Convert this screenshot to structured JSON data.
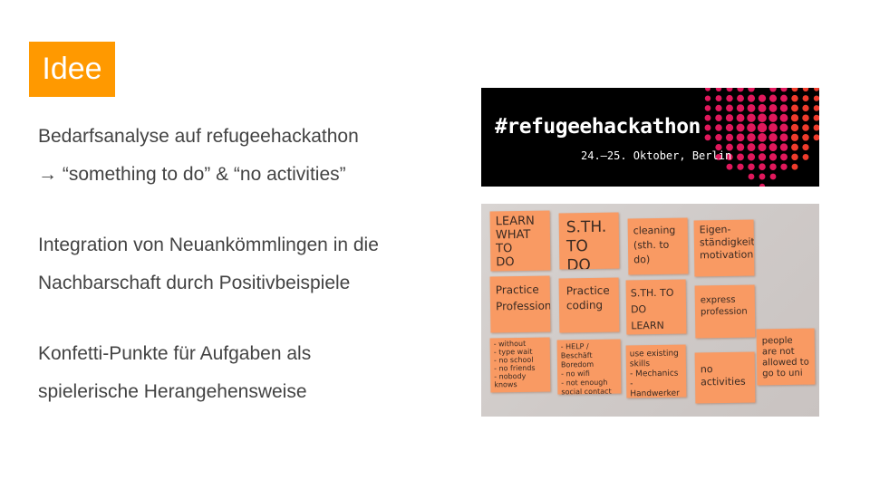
{
  "slide": {
    "title": "Idee",
    "lines": [
      "Bedarfsanalyse auf refugeehackathon",
      "→ “something to do”  &  “no activities”",
      "Integration von Neuankömmlingen in die",
      "Nachbarschaft durch Positivbeispiele",
      "Konfetti-Punkte für Aufgaben als",
      "spielerische Herangehensweise"
    ]
  },
  "banner": {
    "hashtag": "#refugeehackathon",
    "date_place": "24.–25. Oktober, Berlin",
    "colors": {
      "background": "#000000",
      "dots_magenta": "#e0185c",
      "dots_red": "#ef3b2c"
    }
  },
  "photo": {
    "notes": [
      "LEARN\nWHAT TO\nDO",
      "S.TH.\nTO DO",
      "cleaning\n(sth. to do)",
      "Eigen-\nständigkeit\nmotivation",
      "Practice\nProfession",
      "Practice\ncoding",
      "S.TH. TO DO\nLEARN",
      "express\nprofession",
      "- without\n- type wait\n- no school\n- no friends\n- nobody\nknows",
      "- HELP / Beschäft\nBoredom\n- no wifi\n- not enough\nsocial contact",
      "use existing\nskills\n- Mechanics\n- Handwerker",
      "no\nactivities",
      "people\nare not\nallowed to\ngo to uni"
    ]
  },
  "colors": {
    "accent": "#ff9900",
    "text": "#434343"
  }
}
